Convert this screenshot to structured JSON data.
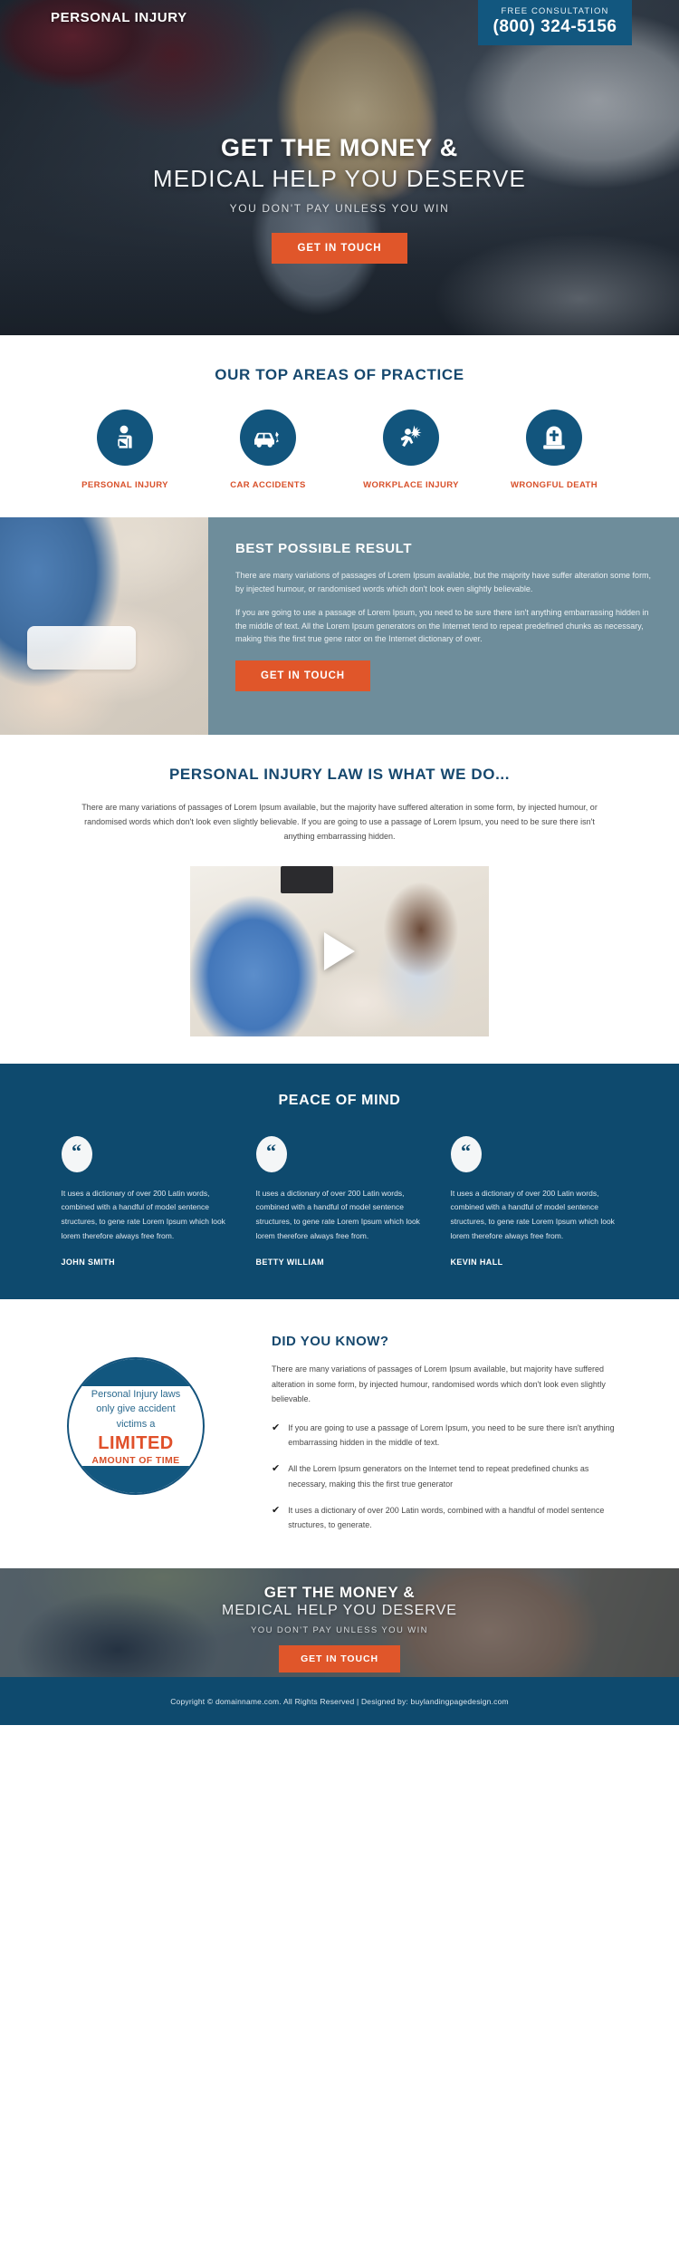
{
  "hero": {
    "brand": "PERSONAL INJURY",
    "phone_label": "FREE CONSULTATION",
    "phone_number": "(800) 324-5156",
    "headline_line1": "GET THE MONEY &",
    "headline_line2": "MEDICAL HELP YOU DESERVE",
    "subheadline": "YOU DON'T PAY UNLESS YOU WIN",
    "cta_label": "GET IN TOUCH"
  },
  "practice": {
    "title": "OUR TOP AREAS OF PRACTICE",
    "items": [
      {
        "label": "PERSONAL INJURY",
        "icon": "person-arm-sling-icon"
      },
      {
        "label": "CAR ACCIDENTS",
        "icon": "car-crash-icon"
      },
      {
        "label": "WORKPLACE INJURY",
        "icon": "falling-worker-icon"
      },
      {
        "label": "WRONGFUL DEATH",
        "icon": "tombstone-cross-icon"
      }
    ]
  },
  "best_result": {
    "title": "BEST POSSIBLE RESULT",
    "paragraph1": "There are many variations of passages of Lorem Ipsum available, but the majority have suffer alteration some form, by injected humour, or randomised words which don't look even slightly believable.",
    "paragraph2": "If you are going to use a passage of Lorem Ipsum, you need to be sure there isn't anything embarrassing hidden in the middle of text. All the Lorem Ipsum generators on the Internet tend to repeat predefined chunks as necessary, making this the first true gene rator on the Internet dictionary of over.",
    "cta_label": "GET IN TOUCH"
  },
  "law": {
    "title": "PERSONAL INJURY LAW IS WHAT WE DO...",
    "intro": "There are many variations of passages of Lorem Ipsum available, but the majority have suffered alteration in some form, by injected humour, or randomised words which don't look even slightly believable. If you are going to use a passage of Lorem Ipsum, you need to be sure there isn't anything embarrassing hidden.",
    "video_play_label": "play-video"
  },
  "peace": {
    "title": "PEACE OF MIND",
    "testimonials": [
      {
        "quote_mark": "“",
        "text": "It uses a dictionary of over 200 Latin words, combined with a handful of model sentence structures, to gene rate Lorem Ipsum which look lorem therefore always free from.",
        "name": "JOHN SMITH"
      },
      {
        "quote_mark": "“",
        "text": "It uses a dictionary of over 200 Latin words, combined with a handful of model sentence structures, to gene rate Lorem Ipsum which look lorem therefore always free from.",
        "name": "BETTY WILLIAM"
      },
      {
        "quote_mark": "“",
        "text": "It uses a dictionary of over 200 Latin words, combined with a handful of model sentence structures, to gene rate Lorem Ipsum which look lorem therefore always free from.",
        "name": "KEVIN HALL"
      }
    ]
  },
  "did_you_know": {
    "badge_line1": "Personal Injury laws only give accident victims a",
    "badge_line2": "LIMITED",
    "badge_line3": "AMOUNT OF TIME",
    "title": "DID YOU KNOW?",
    "paragraph": "There are many variations of passages of Lorem Ipsum available, but majority have suffered alteration in some form, by injected humour, randomised words which don't look even slightly believable.",
    "check_mark": "✔",
    "bullets": [
      "If you are going to use a passage of Lorem Ipsum, you need to be sure there isn't anything embarrassing hidden in the middle of text.",
      "All the Lorem Ipsum generators on the Internet tend to repeat predefined chunks as necessary, making this the first true generator",
      "It uses a dictionary of over 200 Latin words, combined with a handful of model sentence structures, to generate."
    ]
  },
  "bottom_cta": {
    "headline_line1": "GET THE MONEY &",
    "headline_line2": "MEDICAL HELP YOU DESERVE",
    "subheadline": "YOU DON'T PAY UNLESS YOU WIN",
    "cta_label": "GET IN TOUCH"
  },
  "footer": {
    "copyright": "Copyright © domainname.com. All Rights Reserved  |  Designed by: ",
    "designer_link": "buylandingpagedesign.com"
  },
  "colors": {
    "brand_blue": "#0e4a6e",
    "accent_orange": "#e0562a",
    "panel_slate": "#6e8d9b",
    "icon_blue": "#12557d",
    "heading_blue": "#16486e"
  }
}
